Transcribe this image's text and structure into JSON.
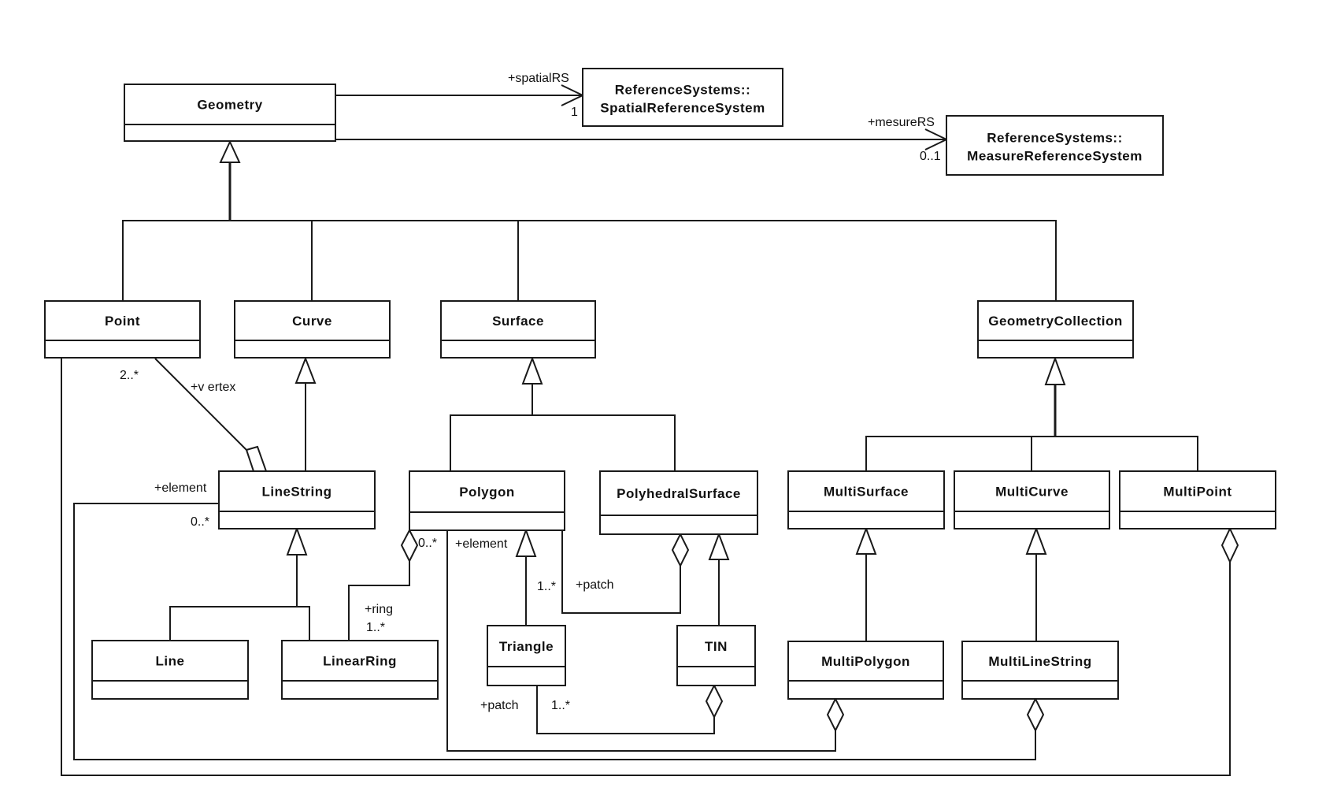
{
  "diagram": {
    "type": "UML class diagram",
    "classes": {
      "geometry": "Geometry",
      "spatial_rs": [
        "ReferenceSystems::",
        "SpatialReferenceSystem"
      ],
      "measure_rs": [
        "ReferenceSystems::",
        "MeasureReferenceSystem"
      ],
      "point": "Point",
      "curve": "Curve",
      "surface": "Surface",
      "geometry_collection": "GeometryCollection",
      "line_string": "LineString",
      "polygon": "Polygon",
      "polyhedral_surface": "PolyhedralSurface",
      "multi_surface": "MultiSurface",
      "multi_curve": "MultiCurve",
      "multi_point": "MultiPoint",
      "line": "Line",
      "linear_ring": "LinearRing",
      "triangle": "Triangle",
      "tin": "TIN",
      "multi_polygon": "MultiPolygon",
      "multi_line_string": "MultiLineString"
    },
    "labels": {
      "spatial_rs_role": "+spatialRS",
      "spatial_rs_mult": "1",
      "measure_rs_role": "+mesureRS",
      "measure_rs_mult": "0..1",
      "vertex_mult": "2..*",
      "vertex_role": "+v ertex",
      "ls_element_role": "+element",
      "ls_element_mult": "0..*",
      "ring_source_mult": "0..*",
      "ring_role": "+ring",
      "ring_mult": "1..*",
      "poly_element_role": "+element",
      "patch_mult_poly": "1..*",
      "patch_role_poly": "+patch",
      "patch_role_tri": "+patch",
      "patch_mult_tri": "1..*"
    },
    "relationships": [
      {
        "type": "association",
        "from": "Geometry",
        "to": "SpatialReferenceSystem",
        "role": "+spatialRS",
        "multiplicity": "1"
      },
      {
        "type": "association",
        "from": "Geometry",
        "to": "MeasureReferenceSystem",
        "role": "+mesureRS",
        "multiplicity": "0..1"
      },
      {
        "type": "generalization",
        "children": [
          "Point",
          "Curve",
          "Surface",
          "GeometryCollection"
        ],
        "parent": "Geometry"
      },
      {
        "type": "generalization",
        "children": [
          "LineString"
        ],
        "parent": "Curve"
      },
      {
        "type": "generalization",
        "children": [
          "Polygon",
          "PolyhedralSurface"
        ],
        "parent": "Surface"
      },
      {
        "type": "generalization",
        "children": [
          "MultiSurface",
          "MultiCurve",
          "MultiPoint"
        ],
        "parent": "GeometryCollection"
      },
      {
        "type": "generalization",
        "children": [
          "Line",
          "LinearRing"
        ],
        "parent": "LineString"
      },
      {
        "type": "generalization",
        "children": [
          "Triangle"
        ],
        "parent": "Polygon"
      },
      {
        "type": "generalization",
        "children": [
          "TIN"
        ],
        "parent": "PolyhedralSurface"
      },
      {
        "type": "generalization",
        "children": [
          "MultiPolygon"
        ],
        "parent": "MultiSurface"
      },
      {
        "type": "generalization",
        "children": [
          "MultiLineString"
        ],
        "parent": "MultiCurve"
      },
      {
        "type": "aggregation",
        "whole": "LineString",
        "part": "Point",
        "role": "+v ertex",
        "multiplicity": "2..*"
      },
      {
        "type": "aggregation",
        "whole": "Polygon",
        "part": "LinearRing",
        "role": "+ring",
        "multiplicity": "1..*"
      },
      {
        "type": "aggregation",
        "whole": "PolyhedralSurface",
        "part": "Polygon",
        "role": "+patch",
        "multiplicity": "1..*"
      },
      {
        "type": "aggregation",
        "whole": "TIN",
        "part": "Triangle",
        "role": "+patch",
        "multiplicity": "1..*"
      },
      {
        "type": "aggregation",
        "whole": "MultiPolygon",
        "part": "Polygon",
        "role": "+element",
        "multiplicity": "0..*"
      },
      {
        "type": "aggregation",
        "whole": "MultiLineString",
        "part": "LineString",
        "role": "+element",
        "multiplicity": "0..*"
      },
      {
        "type": "aggregation",
        "whole": "MultiPoint",
        "part": "Point"
      }
    ]
  }
}
